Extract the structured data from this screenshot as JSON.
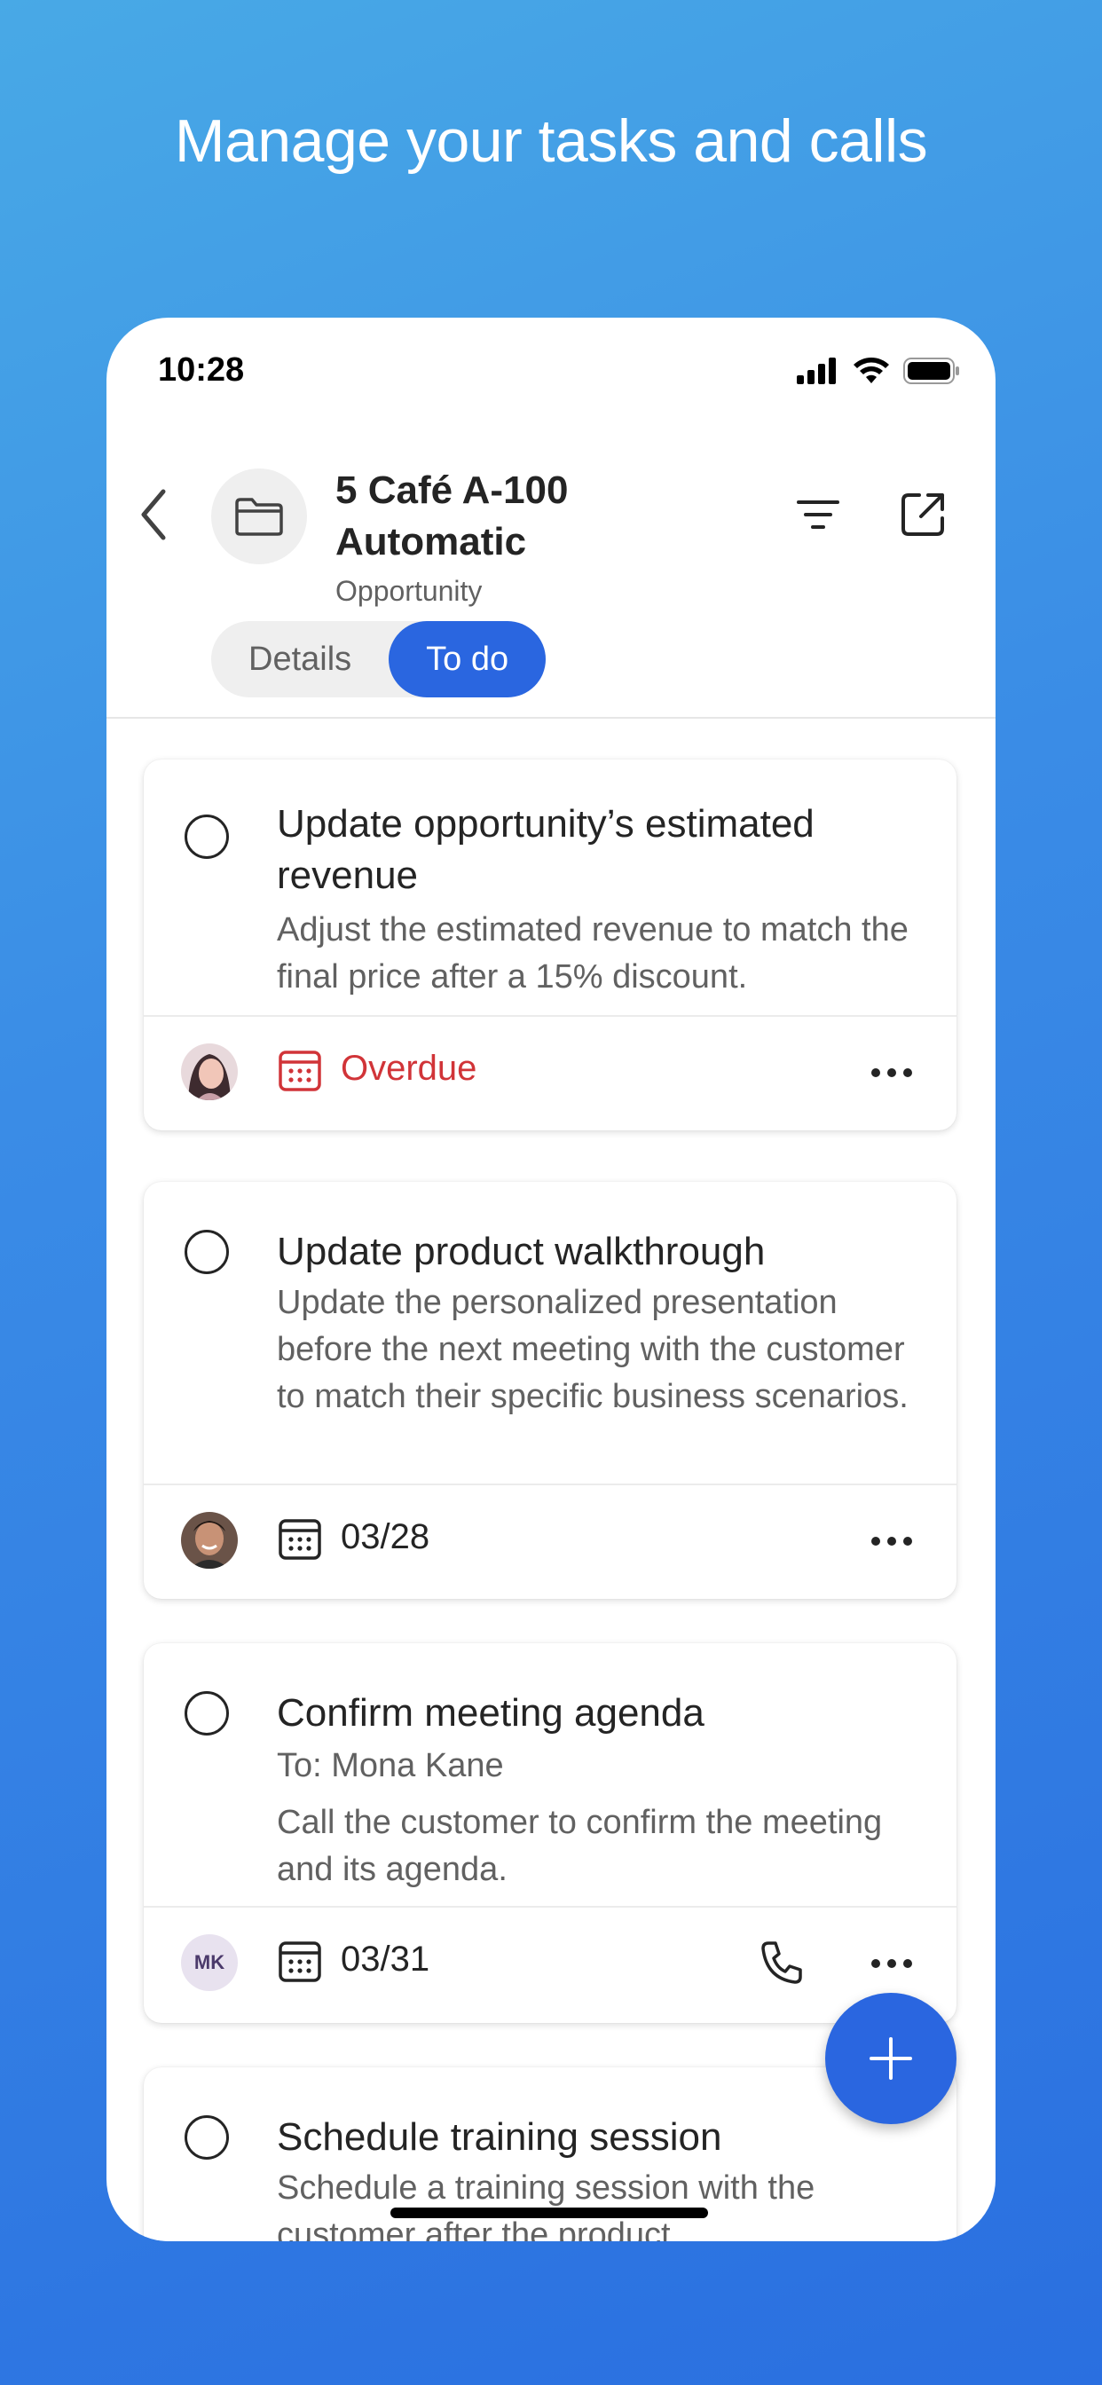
{
  "headline": "Manage your tasks and calls",
  "status_bar": {
    "time": "10:28"
  },
  "header": {
    "title": "5 Café A-100 Automatic",
    "subtitle": "Opportunity",
    "icons": [
      "back-chevron-icon",
      "folder-icon",
      "filter-icon",
      "open-external-icon"
    ]
  },
  "tabs": [
    {
      "label": "Details",
      "active": false
    },
    {
      "label": "To do",
      "active": true
    }
  ],
  "tasks": [
    {
      "title": "Update opportunity’s estimated revenue",
      "description": "Adjust the estimated revenue to match the final price after a 15% discount.",
      "due": "Overdue",
      "due_color": "#d13438"
    },
    {
      "title": "Update product walkthrough",
      "description": "Update the personalized presentation before the next meeting with the customer to match their specific business scenarios.",
      "due": "03/28"
    },
    {
      "title": "Confirm meeting agenda",
      "recipient": "To: Mona Kane",
      "description": "Call the customer to confirm the meeting and its agenda.",
      "avatar_initials": "MK",
      "due": "03/31"
    },
    {
      "title": "Schedule training session",
      "description": "Schedule a training session with the customer after the product"
    }
  ],
  "colors": {
    "accent": "#2a66e0",
    "overdue": "#d13438"
  }
}
